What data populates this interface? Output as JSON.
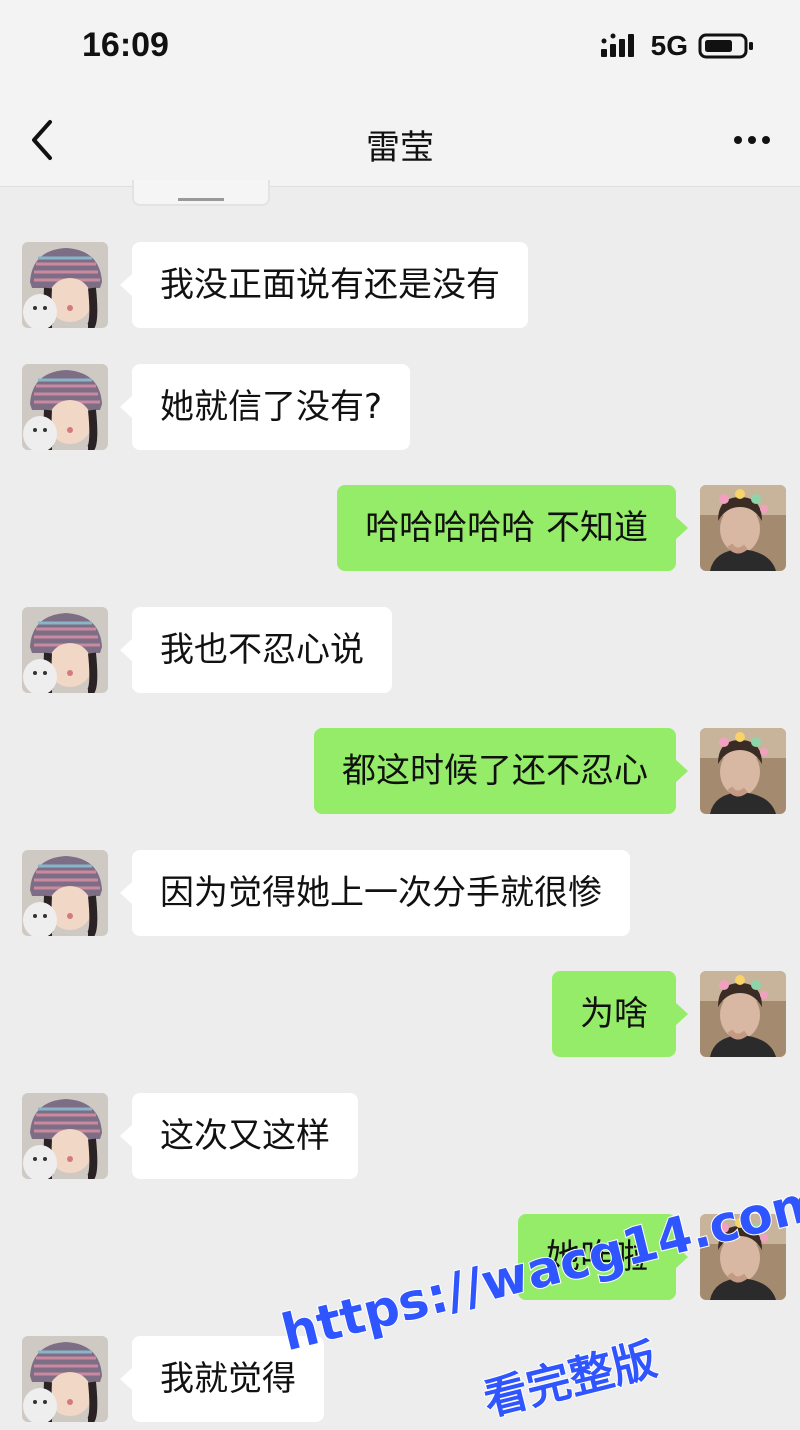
{
  "status_bar": {
    "time": "16:09",
    "network": "5G",
    "signal_icon": "signal-bars-icon",
    "battery_icon": "battery-icon"
  },
  "nav": {
    "title": "雷莹",
    "back_icon": "chevron-left-icon",
    "more_icon": "more-dots-icon"
  },
  "colors": {
    "background": "#ededed",
    "incoming_bubble": "#ffffff",
    "outgoing_bubble": "#95ec69",
    "watermark": "#2e55ff"
  },
  "messages": [
    {
      "side": "left",
      "text": "我没正面说有还是没有"
    },
    {
      "side": "left",
      "text": "她就信了没有?"
    },
    {
      "side": "right",
      "text": "哈哈哈哈哈 不知道"
    },
    {
      "side": "left",
      "text": "我也不忍心说"
    },
    {
      "side": "right",
      "text": "都这时候了还不忍心"
    },
    {
      "side": "left",
      "text": "因为觉得她上一次分手就很惨"
    },
    {
      "side": "right",
      "text": "为啥"
    },
    {
      "side": "left",
      "text": "这次又这样"
    },
    {
      "side": "right",
      "text": "她咋啦"
    },
    {
      "side": "left",
      "text": "我就觉得"
    }
  ],
  "watermark": {
    "url": "https://wacg14.com",
    "cta": "看完整版"
  }
}
